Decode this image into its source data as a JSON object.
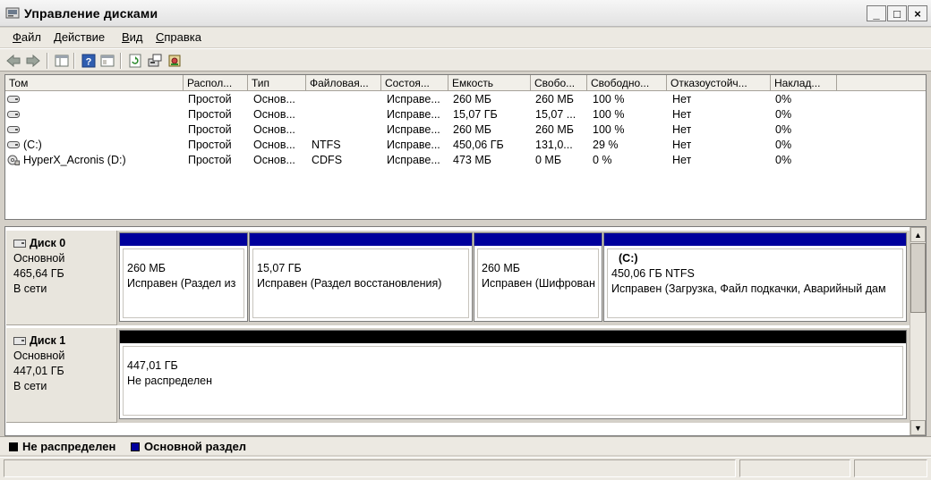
{
  "window": {
    "title": "Управление дисками",
    "controls": {
      "minimize": "_",
      "maximize": "□",
      "close": "×"
    }
  },
  "menu": {
    "items": [
      {
        "mnemonic": "Ф",
        "rest": "айл"
      },
      {
        "mnemonic": "Д",
        "rest": "ействие"
      },
      {
        "mnemonic": "В",
        "rest": "ид"
      },
      {
        "mnemonic": "С",
        "rest": "правка"
      }
    ]
  },
  "toolbar": {
    "icons": [
      "back-arrow-icon",
      "forward-arrow-icon",
      "console-tree-icon",
      "help-icon",
      "properties-view-icon",
      "refresh-icon",
      "rescan-disks-icon",
      "properties-icon"
    ]
  },
  "volume_table": {
    "columns": [
      "Том",
      "Распол...",
      "Тип",
      "Файловая...",
      "Состоя...",
      "Емкость",
      "Свобо...",
      "Свободно...",
      "Отказоустойч...",
      "Наклад..."
    ],
    "rows": [
      [
        "",
        "Простой",
        "Основ...",
        "",
        "Исправе...",
        "260 МБ",
        "260 МБ",
        "100 %",
        "Нет",
        "0%"
      ],
      [
        "",
        "Простой",
        "Основ...",
        "",
        "Исправе...",
        "15,07 ГБ",
        "15,07 ...",
        "100 %",
        "Нет",
        "0%"
      ],
      [
        "",
        "Простой",
        "Основ...",
        "",
        "Исправе...",
        "260 МБ",
        "260 МБ",
        "100 %",
        "Нет",
        "0%"
      ],
      [
        "(C:)",
        "Простой",
        "Основ...",
        "NTFS",
        "Исправе...",
        "450,06 ГБ",
        "131,0...",
        "29 %",
        "Нет",
        "0%"
      ],
      [
        "HyperX_Acronis (D:)",
        "Простой",
        "Основ...",
        "CDFS",
        "Исправе...",
        "473 МБ",
        "0 МБ",
        "0 %",
        "Нет",
        "0%"
      ]
    ]
  },
  "disks": [
    {
      "name": "Диск 0",
      "type": "Основной",
      "size": "465,64 ГБ",
      "status": "В сети",
      "partitions": [
        {
          "label": "",
          "size": "260 МБ",
          "status": "Исправен (Раздел из"
        },
        {
          "label": "",
          "size": "15,07 ГБ",
          "status": "Исправен (Раздел восстановления)"
        },
        {
          "label": "",
          "size": "260 МБ",
          "status": "Исправен (Шифрован"
        },
        {
          "label": "(C:)",
          "size": "450,06 ГБ NTFS",
          "status": "Исправен (Загрузка, Файл подкачки, Аварийный дам"
        }
      ]
    },
    {
      "name": "Диск 1",
      "type": "Основной",
      "size": "447,01 ГБ",
      "status": "В сети",
      "partitions": [
        {
          "label": "",
          "size": "447,01 ГБ",
          "status": "Не распределен"
        }
      ]
    }
  ],
  "legend": [
    {
      "label": "Не распределен",
      "color": "#000000"
    },
    {
      "label": "Основной раздел",
      "color": "#00009c"
    }
  ],
  "colors": {
    "primary_partition": "#00009c",
    "unallocated": "#000000"
  }
}
